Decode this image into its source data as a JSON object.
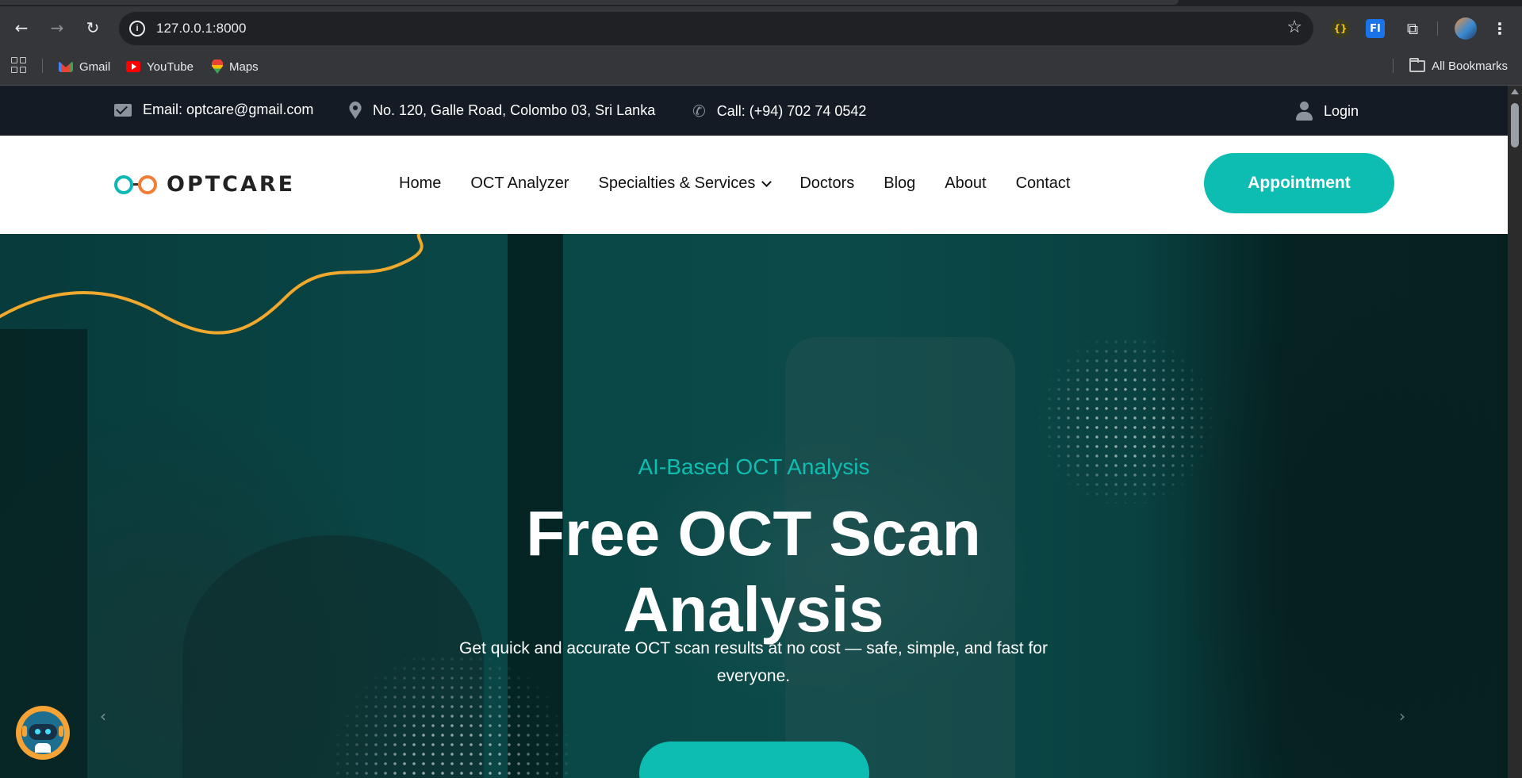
{
  "browser": {
    "url": "127.0.0.1:8000",
    "bookmarks": [
      {
        "label": "Gmail",
        "icon": "gmail-icon"
      },
      {
        "label": "YouTube",
        "icon": "youtube-icon"
      },
      {
        "label": "Maps",
        "icon": "maps-icon"
      }
    ],
    "all_bookmarks_label": "All Bookmarks",
    "extensions": {
      "ext1_glyph": "{}",
      "ext2_glyph": "FI"
    }
  },
  "topbar": {
    "email": "Email: optcare@gmail.com",
    "address": "No. 120, Galle Road, Colombo 03, Sri Lanka",
    "phone": "Call: (+94) 702 74 0542",
    "login": "Login"
  },
  "header": {
    "logo_text": "OPTCARE",
    "nav": [
      "Home",
      "OCT Analyzer",
      "Specialties & Services",
      "Doctors",
      "Blog",
      "About",
      "Contact"
    ],
    "appointment": "Appointment"
  },
  "hero": {
    "subtitle": "AI-Based OCT Analysis",
    "title": "Free OCT Scan Analysis",
    "description": "Get quick and accurate OCT scan results at no cost — safe, simple, and fast for everyone.",
    "prev_arrow": "‹",
    "next_arrow": "›"
  },
  "colors": {
    "accent": "#0dbdb2",
    "topbar_bg": "#141b24",
    "hero_overlay": "#0a4646",
    "logo_orange": "#f27d35",
    "wave": "#f0a92c"
  }
}
